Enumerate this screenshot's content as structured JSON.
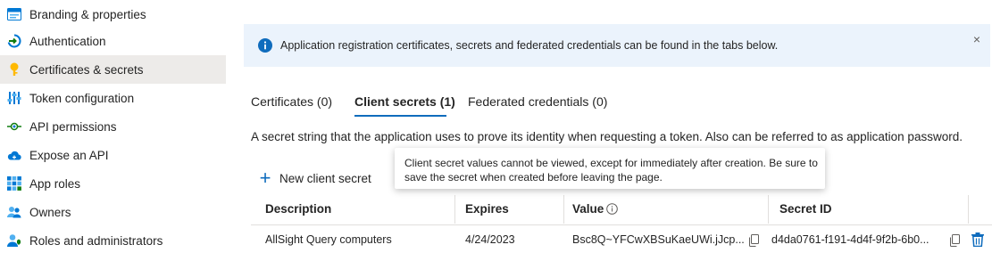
{
  "sidebar": {
    "items": [
      {
        "label": "Branding & properties",
        "icon": "branding-icon",
        "active": false
      },
      {
        "label": "Authentication",
        "icon": "authentication-icon",
        "active": false
      },
      {
        "label": "Certificates & secrets",
        "icon": "key-icon",
        "active": true
      },
      {
        "label": "Token configuration",
        "icon": "token-config-icon",
        "active": false
      },
      {
        "label": "API permissions",
        "icon": "api-permissions-icon",
        "active": false
      },
      {
        "label": "Expose an API",
        "icon": "cloud-icon",
        "active": false
      },
      {
        "label": "App roles",
        "icon": "app-roles-icon",
        "active": false
      },
      {
        "label": "Owners",
        "icon": "owners-icon",
        "active": false
      },
      {
        "label": "Roles and administrators",
        "icon": "roles-admins-icon",
        "active": false
      }
    ]
  },
  "banner": {
    "text": "Application registration certificates, secrets and federated credentials can be found in the tabs below.",
    "close": "×"
  },
  "tabs": [
    {
      "label": "Certificates (0)",
      "selected": false
    },
    {
      "label": "Client secrets (1)",
      "selected": true
    },
    {
      "label": "Federated credentials (0)",
      "selected": false
    }
  ],
  "description": "A secret string that the application uses to prove its identity when requesting a token. Also can be referred to as application password.",
  "new_secret_label": "New client secret",
  "tooltip": "Client secret values cannot be viewed, except for immediately after creation. Be sure to save the secret when created before leaving the page.",
  "table": {
    "headers": {
      "description": "Description",
      "expires": "Expires",
      "value": "Value",
      "secret_id": "Secret ID"
    },
    "rows": [
      {
        "description": "AllSight Query computers",
        "expires": "4/24/2023",
        "value": "Bsc8Q~YFCwXBSuKaeUWi.jJcp...",
        "secret_id": "d4da0761-f191-4d4f-9f2b-6b0..."
      }
    ]
  },
  "colors": {
    "accent": "#0f6cbd",
    "banner_bg": "#ebf3fc",
    "active_item_bg": "#edebe9"
  }
}
